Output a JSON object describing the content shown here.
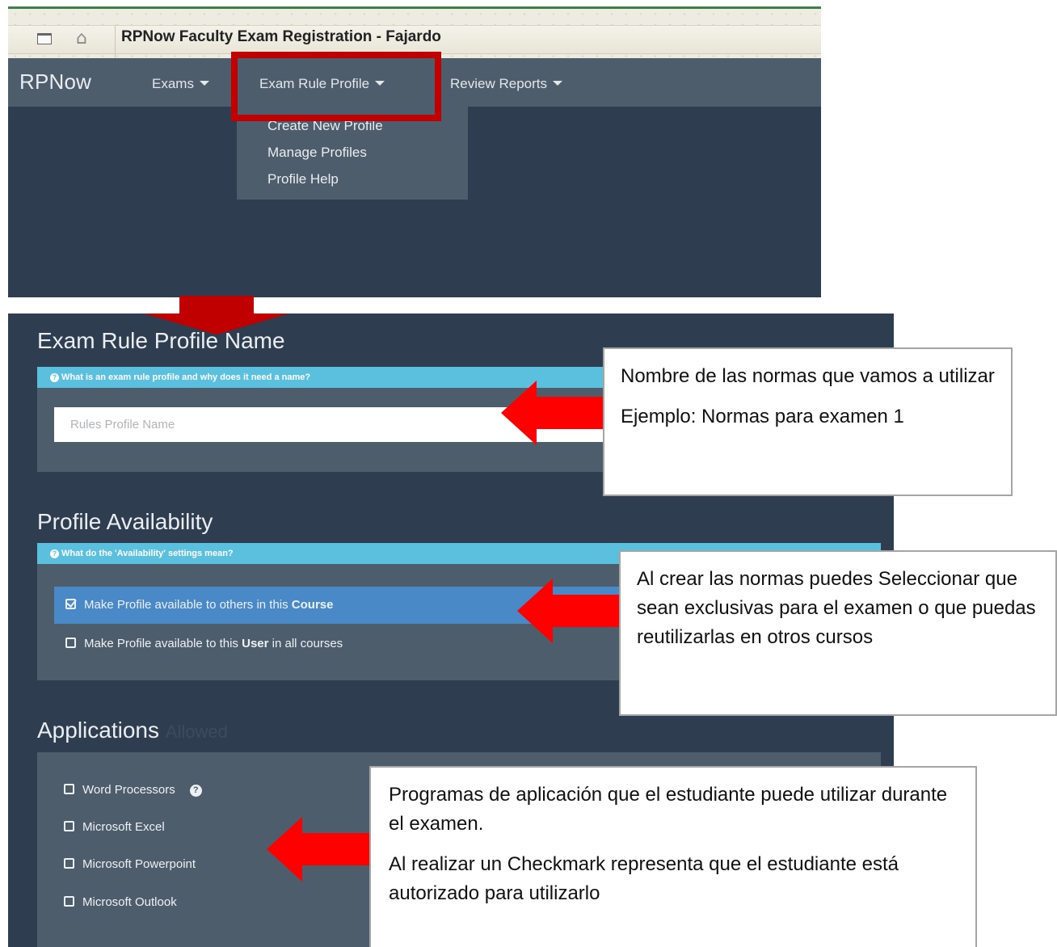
{
  "browser": {
    "title": "RPNow Faculty Exam Registration - Fajardo"
  },
  "navbar": {
    "brand": "RPNow",
    "items": [
      {
        "label": "Exams"
      },
      {
        "label": "Exam Rule Profile"
      },
      {
        "label": "Review Reports"
      }
    ],
    "dropdown": [
      "Create New Profile",
      "Manage Profiles",
      "Profile Help"
    ]
  },
  "form": {
    "name_section": {
      "title": "Exam Rule Profile Name",
      "info": "What is an exam rule profile and why does it need a name?",
      "input_placeholder": "Rules Profile Name",
      "input_value": ""
    },
    "availability_section": {
      "title": "Profile Availability",
      "info": "What do the 'Availability' settings mean?",
      "options": [
        {
          "prefix": "Make Profile available to others in this ",
          "bold": "Course",
          "suffix": "",
          "checked": true
        },
        {
          "prefix": "Make Profile available to this ",
          "bold": "User",
          "suffix": " in all courses",
          "checked": false
        }
      ]
    },
    "applications_section": {
      "title": "Applications",
      "subtitle": "Allowed",
      "apps": [
        {
          "label": "Word Processors",
          "checked": false
        },
        {
          "label": "Microsoft Excel",
          "checked": false
        },
        {
          "label": "Microsoft Powerpoint",
          "checked": false
        },
        {
          "label": "Microsoft Outlook",
          "checked": false
        }
      ]
    }
  },
  "callouts": {
    "name": {
      "line1": "Nombre de las normas que vamos a utilizar",
      "line2": "Ejemplo: Normas para examen 1"
    },
    "availability": {
      "text": "Al crear las normas puedes Seleccionar que sean exclusivas para el examen o que puedas reutilizarlas en otros cursos"
    },
    "applications": {
      "line1": "Programas de aplicación que el estudiante puede utilizar durante el examen.",
      "line2": "Al realizar un Checkmark representa que el estudiante está autorizado para utilizarlo"
    }
  },
  "colors": {
    "dark_bg": "#2e3e50",
    "panel_bg": "#4e5d6c",
    "info_bar": "#5bc0de",
    "selected_row": "#4a89c8",
    "highlight_red": "#c00000",
    "arrow_red": "#ff0000"
  }
}
